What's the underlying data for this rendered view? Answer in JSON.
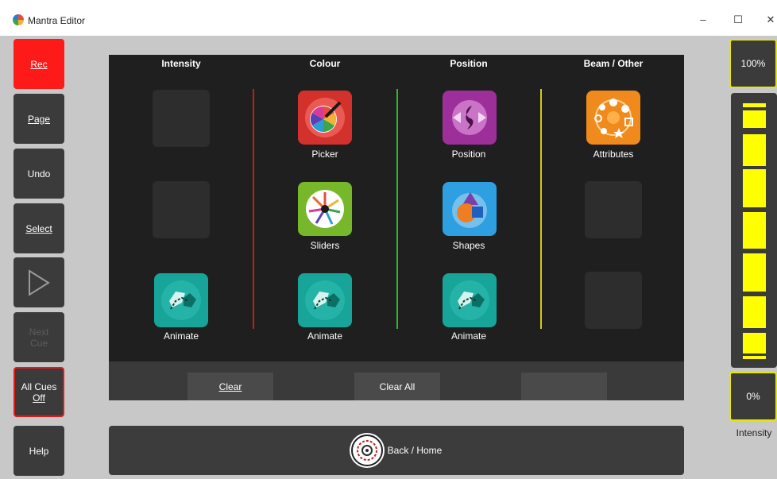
{
  "window": {
    "title": "Mantra Editor",
    "minimize": "–",
    "maximize": "☐",
    "close": "✕"
  },
  "sidebar": {
    "rec": "Rec",
    "page": "Page",
    "undo": "Undo",
    "select": "Select",
    "play_icon": "play-triangle",
    "next_cue_line1": "Next",
    "next_cue_line2": "Cue",
    "all_cues_off_line1": "All Cues",
    "all_cues_off_line2": "Off",
    "help": "Help"
  },
  "columns": {
    "intensity": "Intensity",
    "colour": "Colour",
    "position": "Position",
    "beam": "Beam / Other"
  },
  "tiles": {
    "intensity_animate": "Animate",
    "picker": "Picker",
    "sliders": "Sliders",
    "colour_animate": "Animate",
    "position": "Position",
    "shapes": "Shapes",
    "position_animate": "Animate",
    "attributes": "Attributes"
  },
  "bottom_buttons": {
    "clear": "Clear",
    "clear_all": "Clear All",
    "blank": ""
  },
  "home": {
    "label": "Back / Home"
  },
  "master": {
    "top_value": "100%",
    "bottom_value": "0%",
    "label": "Intensity",
    "level": 1.0
  },
  "colors": {
    "rec": "#ff1a1a",
    "colour_divider": "#c0201a",
    "position_divider": "#2fb52f",
    "beam_divider": "#d4c820",
    "fader": "#ffff00",
    "panel": "#1f1f1f"
  }
}
